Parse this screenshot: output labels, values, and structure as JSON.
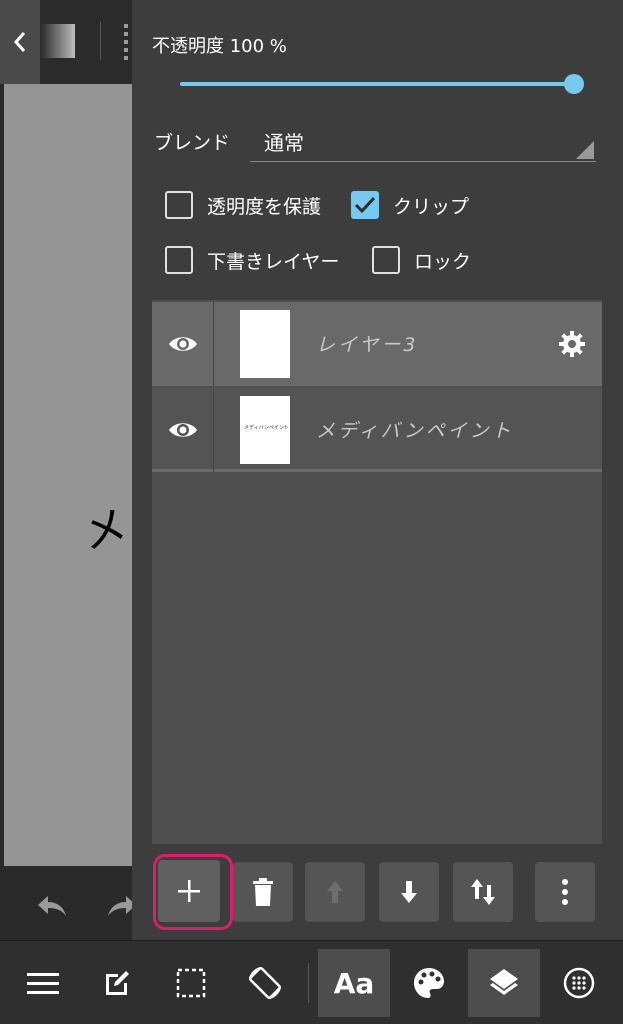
{
  "panel": {
    "opacity_label": "不透明度 100 %",
    "opacity_percent": 100,
    "blend_label": "ブレンド",
    "blend_value": "通常",
    "checkboxes": {
      "protect_alpha": {
        "label": "透明度を保護",
        "checked": false
      },
      "clip": {
        "label": "クリップ",
        "checked": true
      },
      "draft": {
        "label": "下書きレイヤー",
        "checked": false
      },
      "lock": {
        "label": "ロック",
        "checked": false
      }
    }
  },
  "layers": [
    {
      "name": "レイヤー3",
      "selected": true,
      "visible": true
    },
    {
      "name": "メディバンペイント",
      "selected": false,
      "visible": true,
      "thumb_text": "メディバンペイント"
    }
  ],
  "canvas": {
    "glyph": "メ"
  },
  "colors": {
    "accent": "#77c9ef",
    "highlight": "#e01d6b",
    "panel_bg": "#3d3d3d",
    "canvas_bg": "#959595"
  },
  "toolbar": {
    "text_tool_label": "Aa",
    "icons": [
      "menu-icon",
      "edit-icon",
      "selection-icon",
      "rotate-icon",
      "text-icon",
      "palette-icon",
      "layers-icon",
      "grid-icon"
    ]
  },
  "layer_actions": {
    "icons": [
      "add-icon",
      "trash-icon",
      "arrow-up-icon",
      "arrow-down-icon",
      "swap-icon",
      "more-vertical-icon"
    ]
  }
}
